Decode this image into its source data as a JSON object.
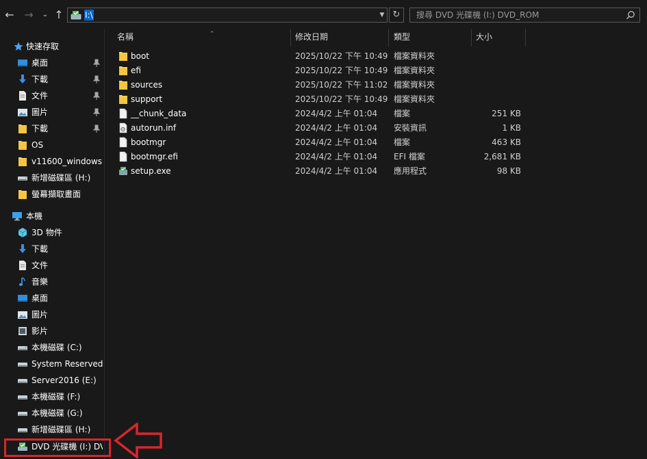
{
  "address_bar": {
    "path": "I:\\"
  },
  "search": {
    "placeholder": "搜尋 DVD 光碟機 (I:) DVD_ROM"
  },
  "sidebar": {
    "quick_access": {
      "label": "快速存取",
      "icon": "star-icon"
    },
    "quick_items": [
      {
        "label": "桌面",
        "icon": "desktop-icon",
        "pinned": true
      },
      {
        "label": "下載",
        "icon": "download-icon",
        "pinned": true
      },
      {
        "label": "文件",
        "icon": "document-icon",
        "pinned": true
      },
      {
        "label": "圖片",
        "icon": "pictures-icon",
        "pinned": true
      },
      {
        "label": "下載",
        "icon": "folder-icon",
        "pinned": true
      },
      {
        "label": "OS",
        "icon": "folder-icon",
        "pinned": false
      },
      {
        "label": "v11600_windows",
        "icon": "folder-icon",
        "pinned": false
      },
      {
        "label": "新增磁碟區 (H:)",
        "icon": "drive-icon",
        "pinned": false
      },
      {
        "label": "螢幕擷取畫面",
        "icon": "folder-icon",
        "pinned": false
      }
    ],
    "this_pc": {
      "label": "本機",
      "icon": "computer-icon"
    },
    "pc_items": [
      {
        "label": "3D 物件",
        "icon": "3d-objects-icon"
      },
      {
        "label": "下載",
        "icon": "download-icon"
      },
      {
        "label": "文件",
        "icon": "document-icon"
      },
      {
        "label": "音樂",
        "icon": "music-icon"
      },
      {
        "label": "桌面",
        "icon": "desktop-icon"
      },
      {
        "label": "圖片",
        "icon": "pictures-icon"
      },
      {
        "label": "影片",
        "icon": "video-icon"
      },
      {
        "label": "本機磁碟 (C:)",
        "icon": "drive-icon"
      },
      {
        "label": "System Reserved (",
        "icon": "drive-icon"
      },
      {
        "label": "Server2016 (E:)",
        "icon": "drive-icon"
      },
      {
        "label": "本機磁碟 (F:)",
        "icon": "drive-icon"
      },
      {
        "label": "本機磁碟 (G:)",
        "icon": "drive-icon"
      },
      {
        "label": "新增磁碟區 (H:)",
        "icon": "drive-icon"
      },
      {
        "label": "DVD 光碟機 (I:) DV",
        "icon": "dvd-drive-icon",
        "selected": true
      }
    ]
  },
  "columns": {
    "name": "名稱",
    "date": "修改日期",
    "type": "類型",
    "size": "大小"
  },
  "files": [
    {
      "name": "boot",
      "date": "2025/10/22 下午 10:49",
      "type": "檔案資料夾",
      "size": "",
      "icon": "folder-icon"
    },
    {
      "name": "efi",
      "date": "2025/10/22 下午 10:49",
      "type": "檔案資料夾",
      "size": "",
      "icon": "folder-icon"
    },
    {
      "name": "sources",
      "date": "2025/10/22 下午 11:02",
      "type": "檔案資料夾",
      "size": "",
      "icon": "folder-icon"
    },
    {
      "name": "support",
      "date": "2025/10/22 下午 10:49",
      "type": "檔案資料夾",
      "size": "",
      "icon": "folder-icon"
    },
    {
      "name": "__chunk_data",
      "date": "2024/4/2 上午 01:04",
      "type": "檔案",
      "size": "251 KB",
      "icon": "file-icon"
    },
    {
      "name": "autorun.inf",
      "date": "2024/4/2 上午 01:04",
      "type": "安裝資訊",
      "size": "1 KB",
      "icon": "settings-file-icon"
    },
    {
      "name": "bootmgr",
      "date": "2024/4/2 上午 01:04",
      "type": "檔案",
      "size": "463 KB",
      "icon": "file-icon"
    },
    {
      "name": "bootmgr.efi",
      "date": "2024/4/2 上午 01:04",
      "type": "EFI 檔案",
      "size": "2,681 KB",
      "icon": "file-icon"
    },
    {
      "name": "setup.exe",
      "date": "2024/4/2 上午 01:04",
      "type": "應用程式",
      "size": "98 KB",
      "icon": "setup-app-icon"
    }
  ],
  "colors": {
    "background": "#191919",
    "highlight": "#d9262c",
    "folder": "#ffd766",
    "selection": "#0a64c8"
  }
}
